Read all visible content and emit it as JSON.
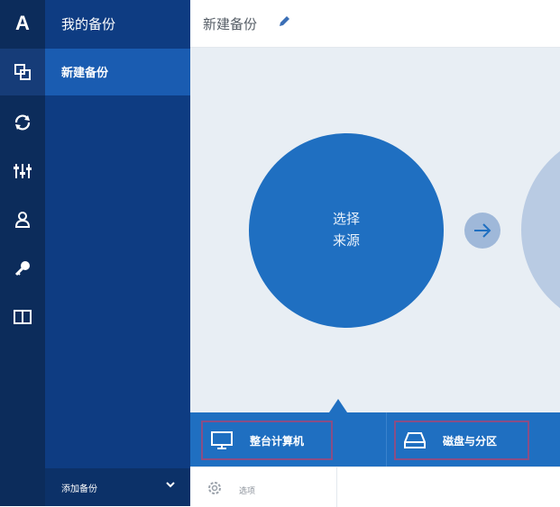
{
  "sidebar": {
    "logo": "A",
    "icons": [
      "backup-icon",
      "sync-icon",
      "tools-icon",
      "account-icon",
      "key-icon",
      "book-icon"
    ],
    "active_icon": "backup-icon"
  },
  "panel": {
    "title": "我的备份",
    "items": [
      {
        "label": "新建备份"
      }
    ],
    "add_backup_label": "添加备份"
  },
  "header": {
    "title": "新建备份",
    "edit_icon": "pencil-icon"
  },
  "main": {
    "source_circle": {
      "line1": "选择",
      "line2": "来源"
    }
  },
  "source_options": [
    {
      "label": "整台计算机",
      "icon": "monitor-icon"
    },
    {
      "label": "磁盘与分区",
      "icon": "disk-icon"
    }
  ],
  "bottom": {
    "options_label": "选项",
    "gear_icon": "gear-icon"
  },
  "colors": {
    "rail_bg": "#0c2c5b",
    "panel_bg": "#0e3c82",
    "active_item": "#1a5cb1",
    "accent": "#1f6fc1",
    "canvas_bg": "#e8eef4",
    "highlight_border": "#8a4e85"
  }
}
